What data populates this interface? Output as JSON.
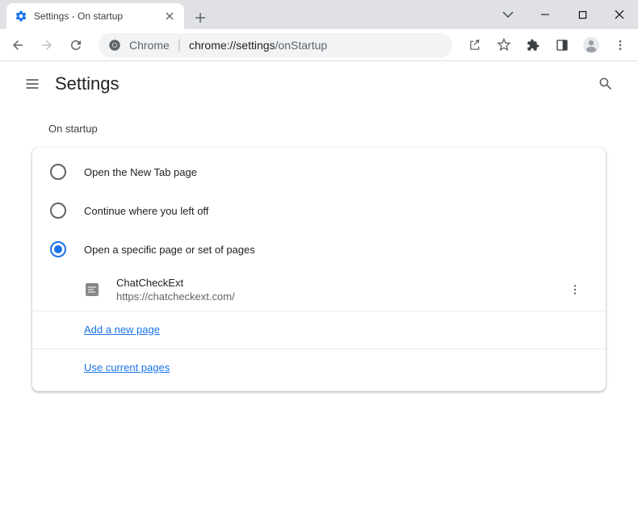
{
  "window": {
    "tab_title": "Settings - On startup"
  },
  "address": {
    "scheme_label": "Chrome",
    "url_base": "chrome://settings",
    "url_sub": "/onStartup"
  },
  "settings": {
    "header_title": "Settings",
    "section_title": "On startup",
    "options": [
      {
        "label": "Open the New Tab page",
        "selected": false
      },
      {
        "label": "Continue where you left off",
        "selected": false
      },
      {
        "label": "Open a specific page or set of pages",
        "selected": true
      }
    ],
    "startup_page": {
      "name": "ChatCheckExt",
      "url": "https://chatcheckext.com/"
    },
    "add_page_label": "Add a new page",
    "use_current_label": "Use current pages"
  },
  "colors": {
    "accent": "#1a73e8",
    "text": "#202124",
    "muted": "#5f6368"
  }
}
